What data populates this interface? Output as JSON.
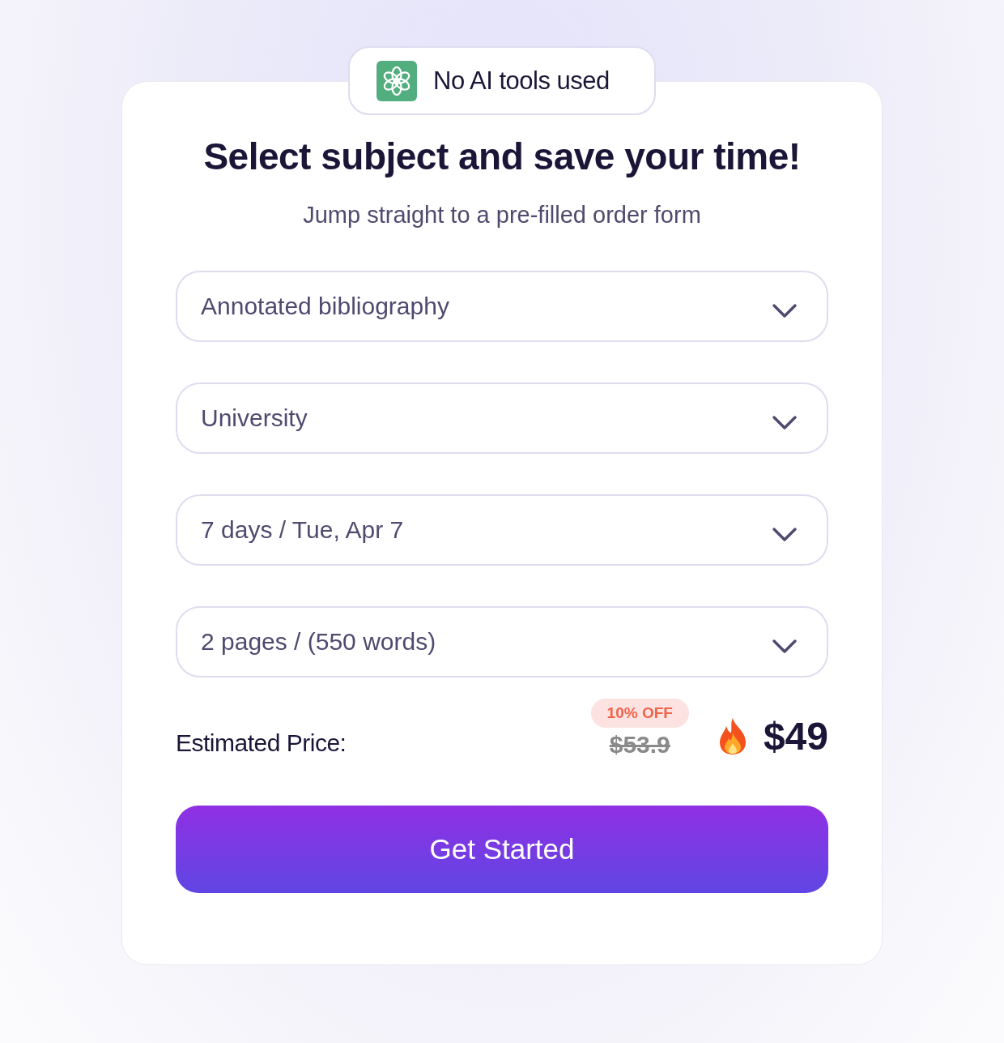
{
  "badge": {
    "label": "No AI tools used"
  },
  "title": "Select subject and save your time!",
  "subtitle": "Jump straight to a pre-filled order form",
  "dropdowns": [
    {
      "value": "Annotated bibliography"
    },
    {
      "value": "University"
    },
    {
      "value": "7 days / Tue, Apr 7"
    },
    {
      "value": "2 pages / (550 words)"
    }
  ],
  "price": {
    "label": "Estimated Price:",
    "discount": "10% OFF",
    "old_price": "$53.9",
    "price": "$49"
  },
  "button": "Get Started"
}
